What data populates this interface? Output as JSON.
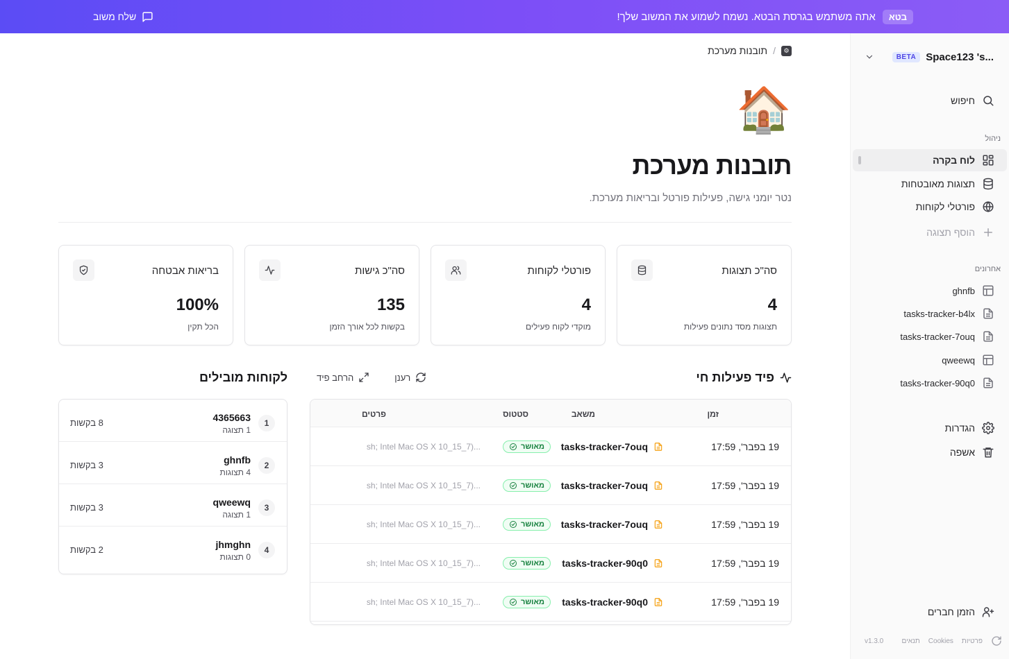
{
  "banner": {
    "badge": "בטא",
    "message": "אתה משתמש בגרסת הבטא. נשמח לשמוע את המשוב שלך!",
    "feedback_label": "שלח משוב",
    "colors": {
      "start": "#5b4cf5",
      "end": "#8b5cf6"
    }
  },
  "sidebar": {
    "workspace_name": "Space123 's...",
    "workspace_badge": "BETA",
    "search_label": "חיפוש",
    "manage_heading": "ניהול",
    "manage_items": [
      {
        "label": "לוח בקרה",
        "icon": "dashboard-icon",
        "active": true
      },
      {
        "label": "תצוגות מאובטחות",
        "icon": "database-icon",
        "active": false
      },
      {
        "label": "פורטלי לקוחות",
        "icon": "globe-icon",
        "active": false
      },
      {
        "label": "הוסף תצוגה",
        "icon": "plus-icon",
        "active": false
      }
    ],
    "recent_heading": "אחרונים",
    "recent_items": [
      {
        "label": "ghnfb",
        "icon": "table-icon"
      },
      {
        "label": "tasks-tracker-b4lx",
        "icon": "document-icon"
      },
      {
        "label": "tasks-tracker-7ouq",
        "icon": "document-icon"
      },
      {
        "label": "qweewq",
        "icon": "table-icon"
      },
      {
        "label": "tasks-tracker-90q0",
        "icon": "document-icon"
      }
    ],
    "settings_label": "הגדרות",
    "trash_label": "אשפה",
    "invite_label": "הזמן חברים",
    "footer": {
      "privacy": "פרטיות",
      "cookies": "Cookies",
      "terms": "תנאים",
      "version": "v1.3.0"
    }
  },
  "breadcrumb": {
    "current": "תובנות מערכת",
    "separator": "/"
  },
  "page": {
    "emoji": "🏠",
    "title": "תובנות מערכת",
    "subtitle": "נטר יומני גישה, פעילות פורטל ובריאות מערכת."
  },
  "stats": [
    {
      "title": "סה\"כ תצוגות",
      "value": "4",
      "note": "תצוגות מסד נתונים פעילות",
      "icon": "database-icon"
    },
    {
      "title": "פורטלי לקוחות",
      "value": "4",
      "note": "מוקדי לקוח פעילים",
      "icon": "users-icon"
    },
    {
      "title": "סה\"כ גישות",
      "value": "135",
      "note": "בקשות לכל אורך הזמן",
      "icon": "activity-icon"
    },
    {
      "title": "בריאות אבטחה",
      "value": "100%",
      "note": "הכל תקין",
      "icon": "shield-check-icon"
    }
  ],
  "feed": {
    "title": "פיד פעילות חי",
    "refresh_label": "רענן",
    "expand_label": "הרחב פיד",
    "columns": {
      "time": "זמן",
      "resource": "משאב",
      "status": "סטטוס",
      "details": "פרטים"
    },
    "rows": [
      {
        "time": "19 בפבר', 17:59",
        "resource": "tasks-tracker-7ouq",
        "status": "מאושר",
        "details": "sh; Intel Mac OS X 10_15_7)..."
      },
      {
        "time": "19 בפבר', 17:59",
        "resource": "tasks-tracker-7ouq",
        "status": "מאושר",
        "details": "sh; Intel Mac OS X 10_15_7)..."
      },
      {
        "time": "19 בפבר', 17:59",
        "resource": "tasks-tracker-7ouq",
        "status": "מאושר",
        "details": "sh; Intel Mac OS X 10_15_7)..."
      },
      {
        "time": "19 בפבר', 17:59",
        "resource": "tasks-tracker-90q0",
        "status": "מאושר",
        "details": "sh; Intel Mac OS X 10_15_7)..."
      },
      {
        "time": "19 בפבר', 17:59",
        "resource": "tasks-tracker-90q0",
        "status": "מאושר",
        "details": "sh; Intel Mac OS X 10_15_7)..."
      }
    ]
  },
  "leaders": {
    "title": "לקוחות מובילים",
    "rows": [
      {
        "rank": "1",
        "name": "4365663",
        "views": "1 תצוגה",
        "requests": "8 בקשות"
      },
      {
        "rank": "2",
        "name": "ghnfb",
        "views": "4 תצוגות",
        "requests": "3 בקשות"
      },
      {
        "rank": "3",
        "name": "qweewq",
        "views": "1 תצוגה",
        "requests": "3 בקשות"
      },
      {
        "rank": "4",
        "name": "jhmghn",
        "views": "0 תצוגות",
        "requests": "2 בקשות"
      }
    ]
  }
}
